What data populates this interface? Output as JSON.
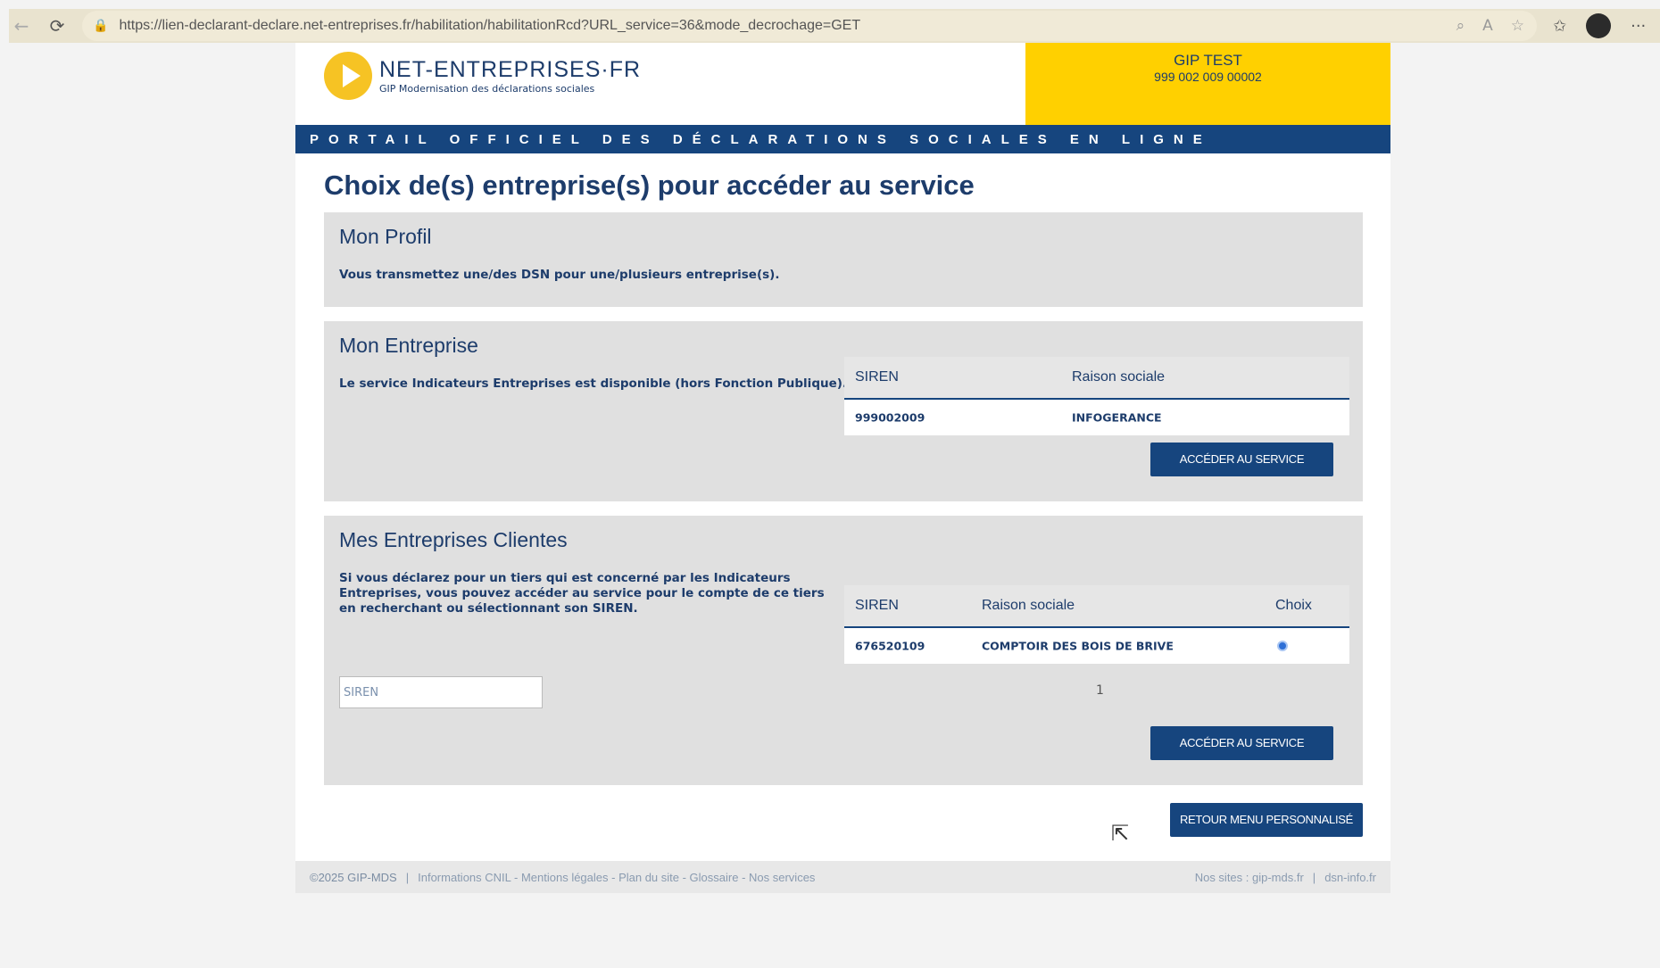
{
  "browser": {
    "url": "https://lien-declarant-declare.net-entreprises.fr/habilitation/habilitationRcd?URL_service=36&mode_decrochage=GET"
  },
  "header": {
    "logo_name": "NET-ENTREPRISES·FR",
    "logo_sub": "GIP Modernisation des déclarations sociales",
    "gip_name": "GIP TEST",
    "gip_siret": "999 002 009 00002",
    "banner": "PORTAIL OFFICIEL DES DÉCLARATIONS SOCIALES EN LIGNE"
  },
  "page_title": "Choix de(s) entreprise(s) pour accéder au service",
  "profil": {
    "title": "Mon Profil",
    "text": "Vous transmettez une/des DSN pour une/plusieurs entreprise(s)."
  },
  "entreprise": {
    "title": "Mon Entreprise",
    "text": "Le service Indicateurs Entreprises est disponible (hors Fonction Publique).",
    "columns": [
      "SIREN",
      "Raison sociale"
    ],
    "rows": [
      {
        "siren": "999002009",
        "raison": "INFOGERANCE"
      }
    ],
    "button": "ACCÉDER AU SERVICE"
  },
  "clientes": {
    "title": "Mes Entreprises Clientes",
    "text": "Si vous déclarez pour un tiers qui est concerné par les Indicateurs Entreprises, vous pouvez accéder au service pour le compte de ce tiers en recherchant ou sélectionnant son SIREN.",
    "input_placeholder": "SIREN",
    "columns": [
      "SIREN",
      "Raison sociale",
      "Choix"
    ],
    "rows": [
      {
        "siren": "676520109",
        "raison": "COMPTOIR DES BOIS DE BRIVE"
      }
    ],
    "page": "1",
    "button": "ACCÉDER AU SERVICE"
  },
  "retour_button": "RETOUR MENU PERSONNALISÉ",
  "footer": {
    "copyright": "©2025 GIP-MDS",
    "links": "Informations CNIL - Mentions légales - Plan du site - Glossaire - Nos services",
    "sites_label": "Nos sites : gip-mds.fr",
    "site2": "dsn-info.fr"
  },
  "colors": {
    "navy": "#16457e",
    "yellow": "#ffd000",
    "card_bg": "#e0e0e0"
  }
}
